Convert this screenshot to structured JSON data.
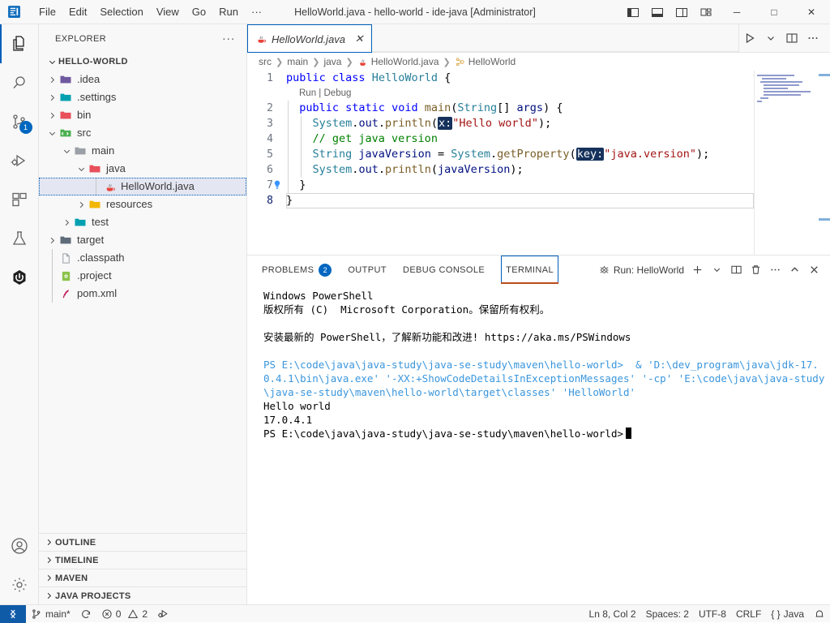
{
  "titlebar": {
    "logo_icon": "vscode-logo-icon",
    "menus": [
      "File",
      "Edit",
      "Selection",
      "View",
      "Go",
      "Run",
      "···"
    ],
    "window_title": "HelloWorld.java - hello-world - ide-java [Administrator]",
    "layout_buttons": [
      {
        "name": "toggle-primary-sidebar-icon",
        "tooltip": "Toggle Primary Side Bar"
      },
      {
        "name": "toggle-panel-icon",
        "tooltip": "Toggle Panel"
      },
      {
        "name": "toggle-secondary-sidebar-icon",
        "tooltip": "Toggle Secondary Side Bar"
      },
      {
        "name": "customize-layout-icon",
        "tooltip": "Customize Layout"
      }
    ],
    "window_controls": {
      "minimize": "─",
      "maximize": "□",
      "close": "✕"
    }
  },
  "activitybar": {
    "items": [
      {
        "name": "explorer",
        "icon": "files-icon",
        "active": true,
        "badge": ""
      },
      {
        "name": "search",
        "icon": "search-icon",
        "active": false,
        "badge": ""
      },
      {
        "name": "source-control",
        "icon": "source-control-icon",
        "active": false,
        "badge": "1"
      },
      {
        "name": "run-and-debug",
        "icon": "run-debug-icon",
        "active": false,
        "badge": ""
      },
      {
        "name": "extensions",
        "icon": "extensions-icon",
        "active": false,
        "badge": ""
      },
      {
        "name": "testing",
        "icon": "beaker-icon",
        "active": false,
        "badge": ""
      },
      {
        "name": "node-dependencies",
        "icon": "hexagon-power-icon",
        "active": false,
        "badge": ""
      }
    ],
    "bottom_items": [
      {
        "name": "accounts",
        "icon": "account-icon"
      },
      {
        "name": "manage",
        "icon": "gear-icon"
      }
    ]
  },
  "sidebar": {
    "header_title": "EXPLORER",
    "more_actions": "···",
    "root_label": "HELLO-WORLD",
    "tree": [
      {
        "label": ".idea",
        "depth": 1,
        "type": "folder",
        "twisty": "right",
        "color": "#6f5a9e",
        "selected": false
      },
      {
        "label": ".settings",
        "depth": 1,
        "type": "folder",
        "twisty": "right",
        "color": "#00a0b0",
        "selected": false
      },
      {
        "label": "bin",
        "depth": 1,
        "type": "folder",
        "twisty": "right",
        "color": "#e8505b",
        "selected": false
      },
      {
        "label": "src",
        "depth": 1,
        "type": "folder-src",
        "twisty": "down",
        "color": "#4caf50",
        "selected": false
      },
      {
        "label": "main",
        "depth": 2,
        "type": "folder",
        "twisty": "down",
        "color": "#9aa0a6",
        "selected": false
      },
      {
        "label": "java",
        "depth": 3,
        "type": "folder",
        "twisty": "down",
        "color": "#e8505b",
        "selected": false
      },
      {
        "label": "HelloWorld.java",
        "depth": 4,
        "type": "java",
        "twisty": "none",
        "color": "#cc3e44",
        "selected": true
      },
      {
        "label": "resources",
        "depth": 3,
        "type": "folder",
        "twisty": "right",
        "color": "#f2b705",
        "selected": false
      },
      {
        "label": "test",
        "depth": 2,
        "type": "folder",
        "twisty": "right",
        "color": "#00a0b0",
        "selected": false
      },
      {
        "label": "target",
        "depth": 1,
        "type": "folder",
        "twisty": "right",
        "color": "#5f6b7a",
        "selected": false
      },
      {
        "label": ".classpath",
        "depth": 1,
        "type": "file",
        "twisty": "none",
        "color": "#9aa0a6",
        "selected": false
      },
      {
        "label": ".project",
        "depth": 1,
        "type": "xml",
        "twisty": "none",
        "color": "#8bc34a",
        "selected": false
      },
      {
        "label": "pom.xml",
        "depth": 1,
        "type": "maven",
        "twisty": "none",
        "color": "#c2185b",
        "selected": false
      }
    ],
    "sections": [
      "OUTLINE",
      "TIMELINE",
      "MAVEN",
      "JAVA PROJECTS"
    ]
  },
  "editor": {
    "tab": {
      "label": "HelloWorld.java",
      "icon": "java-file-icon",
      "close": "✕",
      "dirty": false
    },
    "actions": [
      {
        "name": "run-java-button",
        "icon": "play-icon"
      },
      {
        "name": "run-options-dropdown",
        "icon": "chevron-down-icon"
      },
      {
        "name": "split-editor-right-button",
        "icon": "split-editor-icon"
      },
      {
        "name": "more-editor-actions-button",
        "icon": "ellipsis-icon"
      }
    ],
    "breadcrumb": [
      {
        "label": "src",
        "icon": ""
      },
      {
        "label": "main",
        "icon": ""
      },
      {
        "label": "java",
        "icon": ""
      },
      {
        "label": "HelloWorld.java",
        "icon": "java-file-icon"
      },
      {
        "label": "HelloWorld",
        "icon": "class-icon"
      }
    ],
    "codelens": {
      "run": "Run",
      "sep": "|",
      "debug": "Debug"
    },
    "lines": [
      {
        "num": "1",
        "tokens": [
          {
            "t": "public ",
            "c": "t-key"
          },
          {
            "t": "class ",
            "c": "t-key"
          },
          {
            "t": "HelloWorld ",
            "c": "t-cls"
          },
          {
            "t": "{",
            "c": "t-pln"
          }
        ],
        "indent": 0
      },
      {
        "num": "2",
        "tokens": [
          {
            "t": "  ",
            "c": "t-pln"
          },
          {
            "t": "public ",
            "c": "t-key"
          },
          {
            "t": "static ",
            "c": "t-key"
          },
          {
            "t": "void ",
            "c": "t-key"
          },
          {
            "t": "main",
            "c": "t-fn"
          },
          {
            "t": "(",
            "c": "t-pln"
          },
          {
            "t": "String",
            "c": "t-cls"
          },
          {
            "t": "[] ",
            "c": "t-pln"
          },
          {
            "t": "args",
            "c": "t-var"
          },
          {
            "t": ") {",
            "c": "t-pln"
          }
        ],
        "indent": 1
      },
      {
        "num": "3",
        "tokens": [
          {
            "t": "    ",
            "c": "t-pln"
          },
          {
            "t": "System",
            "c": "t-cls"
          },
          {
            "t": ".",
            "c": "t-pln"
          },
          {
            "t": "out",
            "c": "t-var"
          },
          {
            "t": ".",
            "c": "t-pln"
          },
          {
            "t": "println",
            "c": "t-fn"
          },
          {
            "t": "(",
            "c": "t-pln"
          },
          {
            "t": "x:",
            "c": "t-hint"
          },
          {
            "t": "\"Hello world\"",
            "c": "t-str"
          },
          {
            "t": ");",
            "c": "t-pln"
          }
        ],
        "indent": 2
      },
      {
        "num": "4",
        "tokens": [
          {
            "t": "    ",
            "c": "t-pln"
          },
          {
            "t": "// get java version",
            "c": "t-cmt"
          }
        ],
        "indent": 2
      },
      {
        "num": "5",
        "tokens": [
          {
            "t": "    ",
            "c": "t-pln"
          },
          {
            "t": "String ",
            "c": "t-cls"
          },
          {
            "t": "javaVersion ",
            "c": "t-var"
          },
          {
            "t": "= ",
            "c": "t-pln"
          },
          {
            "t": "System",
            "c": "t-cls"
          },
          {
            "t": ".",
            "c": "t-pln"
          },
          {
            "t": "getProperty",
            "c": "t-fn"
          },
          {
            "t": "(",
            "c": "t-pln"
          },
          {
            "t": "key:",
            "c": "t-hint"
          },
          {
            "t": "\"java.version\"",
            "c": "t-str"
          },
          {
            "t": ");",
            "c": "t-pln"
          }
        ],
        "indent": 2
      },
      {
        "num": "6",
        "tokens": [
          {
            "t": "    ",
            "c": "t-pln"
          },
          {
            "t": "System",
            "c": "t-cls"
          },
          {
            "t": ".",
            "c": "t-pln"
          },
          {
            "t": "out",
            "c": "t-var"
          },
          {
            "t": ".",
            "c": "t-pln"
          },
          {
            "t": "println",
            "c": "t-fn"
          },
          {
            "t": "(",
            "c": "t-pln"
          },
          {
            "t": "javaVersion",
            "c": "t-var"
          },
          {
            "t": ");",
            "c": "t-pln"
          }
        ],
        "indent": 2
      },
      {
        "num": "7",
        "tokens": [
          {
            "t": "  ",
            "c": "t-pln"
          },
          {
            "t": "}",
            "c": "t-pln"
          }
        ],
        "indent": 1,
        "lightbulb": true
      },
      {
        "num": "8",
        "tokens": [
          {
            "t": "}",
            "c": "t-pln"
          }
        ],
        "indent": 0,
        "current": true
      }
    ]
  },
  "panel": {
    "tabs": [
      {
        "label": "PROBLEMS",
        "badge": "2",
        "active": false
      },
      {
        "label": "OUTPUT",
        "badge": "",
        "active": false
      },
      {
        "label": "DEBUG CONSOLE",
        "badge": "",
        "active": false
      },
      {
        "label": "TERMINAL",
        "badge": "",
        "active": true
      }
    ],
    "terminal_selector": {
      "icon": "debug-console-icon",
      "label": "Run: HelloWorld"
    },
    "actions": [
      {
        "name": "new-terminal-button",
        "icon": "plus-icon"
      },
      {
        "name": "terminal-profile-dropdown",
        "icon": "chevron-down-icon"
      },
      {
        "name": "split-terminal-button",
        "icon": "split-icon"
      },
      {
        "name": "kill-terminal-button",
        "icon": "trash-icon"
      },
      {
        "name": "panel-more-actions-button",
        "icon": "ellipsis-icon"
      },
      {
        "name": "maximize-panel-button",
        "icon": "chevron-up-icon"
      },
      {
        "name": "close-panel-button",
        "icon": "close-icon"
      }
    ],
    "terminal_lines": [
      {
        "text": "Windows PowerShell",
        "style": "plain"
      },
      {
        "text": "版权所有 (C)  Microsoft Corporation。保留所有权利。",
        "style": "plain"
      },
      {
        "text": "",
        "style": "plain"
      },
      {
        "text": "安装最新的 PowerShell，了解新功能和改进! https://aka.ms/PSWindows",
        "style": "plain"
      },
      {
        "text": "",
        "style": "plain"
      },
      {
        "text": "PS E:\\code\\java\\java-study\\java-se-study\\maven\\hello-world>  & 'D:\\dev_program\\java\\jdk-17.0.4.1\\bin\\java.exe' '-XX:+ShowCodeDetailsInExceptionMessages' '-cp' 'E:\\code\\java\\java-study\\java-se-study\\maven\\hello-world\\target\\classes' 'HelloWorld'",
        "style": "cyan"
      },
      {
        "text": "Hello world",
        "style": "plain"
      },
      {
        "text": "17.0.4.1",
        "style": "plain"
      },
      {
        "text": "PS E:\\code\\java\\java-study\\java-se-study\\maven\\hello-world>",
        "style": "prompt-cursor"
      }
    ]
  },
  "statusbar": {
    "remote_icon": "remote-window-icon",
    "left_items": [
      {
        "name": "branch",
        "icon": "source-control-icon",
        "label": "main*"
      },
      {
        "name": "sync-changes",
        "icon": "sync-icon",
        "label": ""
      },
      {
        "name": "problems",
        "icon": "error-warning-icon",
        "label": "0",
        "label2": "2"
      },
      {
        "name": "run-java",
        "icon": "run-icon",
        "label": ""
      }
    ],
    "right_items": [
      {
        "name": "editor-position",
        "label": "Ln 8, Col 2"
      },
      {
        "name": "indentation",
        "label": "Spaces: 2"
      },
      {
        "name": "encoding",
        "label": "UTF-8"
      },
      {
        "name": "eol",
        "label": "CRLF"
      },
      {
        "name": "language-mode",
        "label": "Java",
        "prefix": "{ }"
      },
      {
        "name": "notifications",
        "icon": "bell-icon",
        "label": ""
      }
    ]
  },
  "colors": {
    "accent": "#005fb8",
    "badge": "#0067c0",
    "remote_bg": "#0f5ba8",
    "terminal_cyan": "#3a96dd",
    "tab_underline": "#bb4b1e"
  }
}
